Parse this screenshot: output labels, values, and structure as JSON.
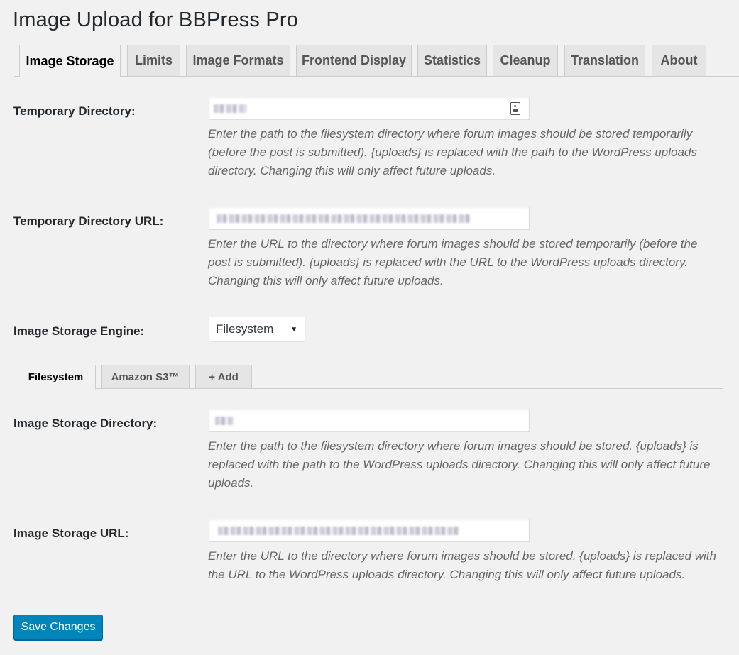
{
  "page": {
    "title": "Image Upload for BBPress Pro"
  },
  "tabs": [
    {
      "label": "Image Storage"
    },
    {
      "label": "Limits"
    },
    {
      "label": "Image Formats"
    },
    {
      "label": "Frontend Display"
    },
    {
      "label": "Statistics"
    },
    {
      "label": "Cleanup"
    },
    {
      "label": "Translation"
    },
    {
      "label": "About"
    }
  ],
  "fields": {
    "temp_dir": {
      "label": "Temporary Directory:",
      "description": "Enter the path to the filesystem directory where forum images should be stored temporarily (before the post is submitted). {uploads} is replaced with the path to the WordPress uploads directory. Changing this will only affect future uploads."
    },
    "temp_url": {
      "label": "Temporary Directory URL:",
      "description": "Enter the URL to the directory where forum images should be stored temporarily (before the post is submitted). {uploads} is replaced with the URL to the WordPress uploads directory. Changing this will only affect future uploads."
    },
    "engine": {
      "label": "Image Storage Engine:",
      "selected": "Filesystem"
    },
    "storage_dir": {
      "label": "Image Storage Directory:",
      "description": "Enter the path to the filesystem directory where forum images should be stored. {uploads} is replaced with the path to the WordPress uploads directory. Changing this will only affect future uploads."
    },
    "storage_url": {
      "label": "Image Storage URL:",
      "description": "Enter the URL to the directory where forum images should be stored. {uploads} is replaced with the URL to the WordPress uploads directory. Changing this will only affect future uploads."
    }
  },
  "sub_tabs": [
    {
      "label": "Filesystem"
    },
    {
      "label": "Amazon S3™"
    },
    {
      "label": "+ Add"
    }
  ],
  "actions": {
    "save_label": "Save Changes"
  },
  "colors": {
    "primary_button": "#0085ba",
    "background": "#f1f1f1"
  },
  "icons": {
    "temp_dir_field": "key-icon"
  }
}
